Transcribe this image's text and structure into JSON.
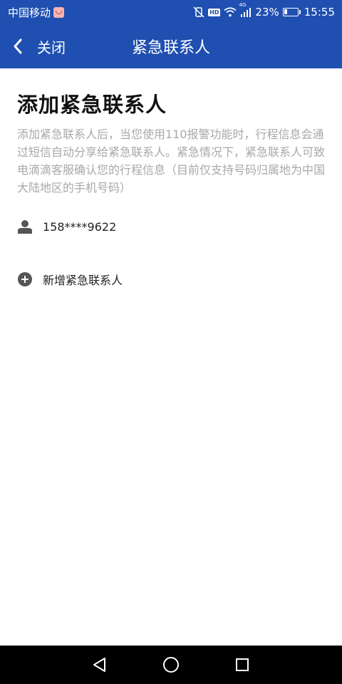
{
  "status_bar": {
    "carrier": "中国移动",
    "hd_label": "HD",
    "network_label": "4G",
    "battery_percent": "23%",
    "battery_level": 0.23,
    "time": "15:55"
  },
  "app_bar": {
    "back_label": "关闭",
    "title": "紧急联系人"
  },
  "main": {
    "heading": "添加紧急联系人",
    "description": "添加紧急联系人后，当您使用110报警功能时，行程信息会通过短信自动分享给紧急联系人。紧急情况下，紧急联系人可致电滴滴客服确认您的行程信息（目前仅支持号码归属地为中国大陆地区的手机号码）",
    "contacts": [
      {
        "phone": "158****9622",
        "icon": "person-icon"
      }
    ],
    "add_contact_label": "新增紧急联系人",
    "add_contact_icon": "plus-circle-icon"
  },
  "nav_bar": {
    "buttons": [
      "back-triangle-icon",
      "home-circle-icon",
      "recents-square-icon"
    ]
  },
  "colors": {
    "primary": "#1f4fb0",
    "description_text": "#a8a8a8",
    "icon_gray": "#555555"
  }
}
